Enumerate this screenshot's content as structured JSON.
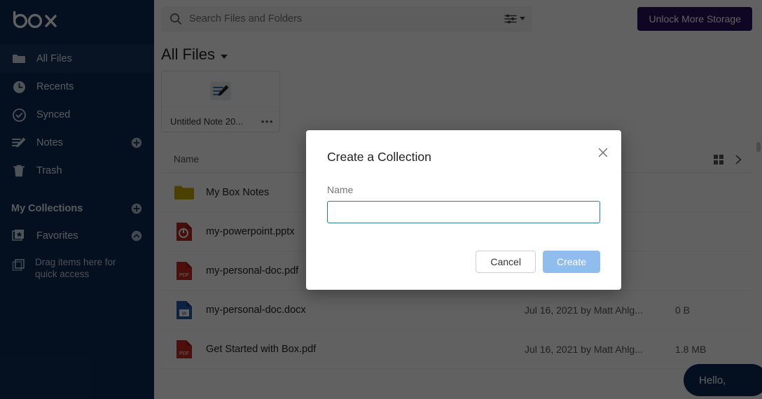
{
  "brand": {
    "logo_text": "box",
    "sidebar_bg": "#0d2a54",
    "accent": "#26105c",
    "primary_button": "#90bdee",
    "input_focus_border": "#2d7d8a"
  },
  "sidebar": {
    "items": [
      {
        "label": "All Files",
        "icon": "folder-icon",
        "active": true,
        "action_icon": null
      },
      {
        "label": "Recents",
        "icon": "clock-icon",
        "active": false,
        "action_icon": null
      },
      {
        "label": "Synced",
        "icon": "check-circle-icon",
        "active": false,
        "action_icon": null
      },
      {
        "label": "Notes",
        "icon": "notes-icon",
        "active": false,
        "action_icon": "plus-circle-icon"
      },
      {
        "label": "Trash",
        "icon": "trash-icon",
        "active": false,
        "action_icon": null
      }
    ],
    "collections_header": {
      "label": "My Collections",
      "action_icon": "plus-circle-icon"
    },
    "favorites": {
      "label": "Favorites",
      "icon": "favorites-icon",
      "action_icon": "chevron-up-circle-icon"
    },
    "drag_hint": "Drag items here for quick access"
  },
  "topbar": {
    "search_placeholder": "Search Files and Folders",
    "search_value": "",
    "filter_icon": "sliders-icon",
    "unlock_label": "Unlock More Storage"
  },
  "main": {
    "page_title": "All Files",
    "cards": [
      {
        "name": "Untitled Note 20...",
        "icon": "box-note-icon",
        "menu": "•••"
      }
    ],
    "list": {
      "columns": {
        "name": "Name"
      },
      "view_grid_icon": "grid-view-icon",
      "next_icon": "chevron-right-icon",
      "rows": [
        {
          "name": "My Box Notes",
          "type": "folder",
          "updated": "",
          "size": ""
        },
        {
          "name": "my-powerpoint.pptx",
          "type": "pptx",
          "updated": "",
          "size": ""
        },
        {
          "name": "my-personal-doc.pdf",
          "type": "pdf",
          "updated": "",
          "size": ""
        },
        {
          "name": "my-personal-doc.docx",
          "type": "docx",
          "updated": "Jul 16, 2021 by Matt Ahlg...",
          "size": "0 B"
        },
        {
          "name": "Get Started with Box.pdf",
          "type": "pdf",
          "updated": "Jul 16, 2021 by Matt Ahlg...",
          "size": "1.8 MB"
        }
      ]
    },
    "chat_widget": {
      "label": "Hello,"
    }
  },
  "modal": {
    "title": "Create a Collection",
    "close_icon": "close-icon",
    "field_label": "Name",
    "field_value": "",
    "field_placeholder": "",
    "cancel_label": "Cancel",
    "create_label": "Create"
  }
}
